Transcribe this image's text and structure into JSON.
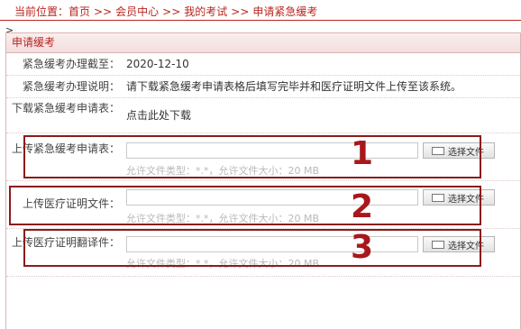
{
  "breadcrumb": {
    "prefix": "当前位置：",
    "sep": ">>",
    "items": [
      "首页",
      "会员中心",
      "我的考试",
      "申请紧急缓考"
    ]
  },
  "caret": ">",
  "panel": {
    "title": "申请缓考",
    "deadline_label": "紧急缓考办理截至：",
    "deadline_value": "2020-12-10",
    "instruction_label": "紧急缓考办理说明：",
    "instruction_value": "请下载紧急缓考申请表格后填写完毕并和医疗证明文件上传至该系统。",
    "download_label": "下载紧急缓考申请表：",
    "download_link": "点击此处下载",
    "uploads": [
      {
        "label": "上传紧急缓考申请表：",
        "button": "选择文件",
        "hint": "允许文件类型：*.*，允许文件大小：20 MB",
        "annotation": "1"
      },
      {
        "label": "上传医疗证明文件：",
        "button": "选择文件",
        "hint": "允许文件类型：*.*，允许文件大小：20 MB",
        "annotation": "2"
      },
      {
        "label": "上传医疗证明翻译件：",
        "button": "选择文件",
        "hint": "允许文件类型：*.*，允许文件大小：20 MB",
        "annotation": "3"
      }
    ]
  },
  "colors": {
    "accent": "#b8261f",
    "annotation": "#a7181c",
    "hint": "#b9b9b9"
  },
  "icons": [
    "folder-icon"
  ]
}
